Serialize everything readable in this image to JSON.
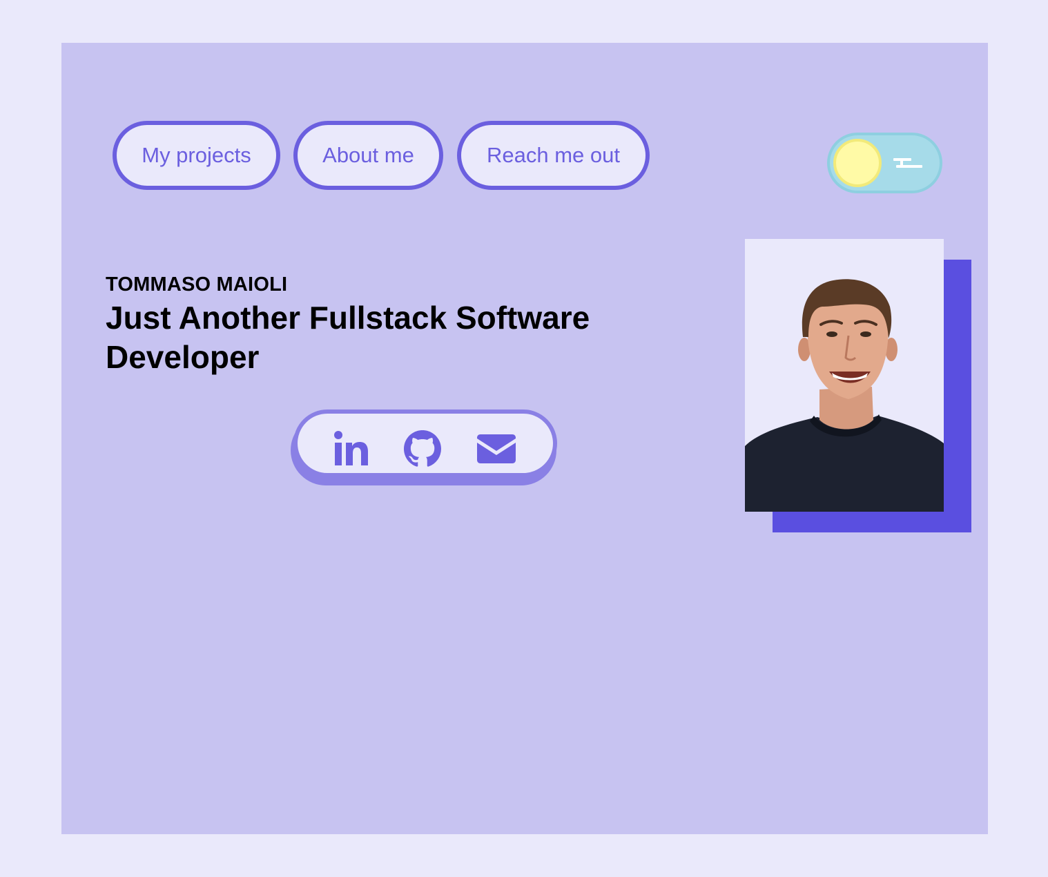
{
  "nav": {
    "projects_label": "My projects",
    "about_label": "About me",
    "reach_label": "Reach me out"
  },
  "theme_toggle": {
    "state": "light",
    "knob_icon": "sun-icon",
    "track_icon": "cloud-icon"
  },
  "hero": {
    "name": "TOMMASO MAIOLI",
    "headline": "Just Another Fullstack Software Developer"
  },
  "social": {
    "icons": [
      "linkedin-icon",
      "github-icon",
      "mail-icon"
    ]
  },
  "profile_photo": {
    "subject": "smiling man with short brown hair in dark navy t-shirt"
  },
  "colors": {
    "page_background": "#eae9fb",
    "panel_background": "#c7c3f1",
    "accent": "#6b5fdf",
    "photo_accent": "#5a4fe0",
    "toggle_track": "#a6dbe9",
    "toggle_knob": "#fffaa6"
  }
}
